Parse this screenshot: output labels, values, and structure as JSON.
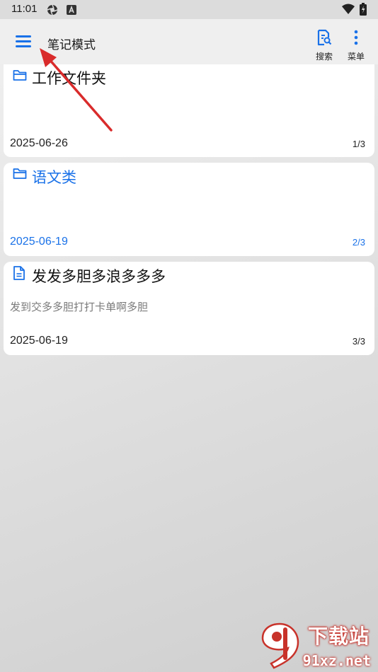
{
  "status_bar": {
    "time": "11:01"
  },
  "app_bar": {
    "title": "笔记模式",
    "actions": [
      {
        "label": "搜索",
        "icon": "search-note-icon"
      },
      {
        "label": "菜单",
        "icon": "more-vert-icon"
      }
    ]
  },
  "notes": [
    {
      "type": "folder",
      "title": "工作文件夹",
      "preview": "",
      "date": "2025-06-26",
      "position": "1/3",
      "accent": false
    },
    {
      "type": "folder",
      "title": "语文类",
      "preview": "",
      "date": "2025-06-19",
      "position": "2/3",
      "accent": true
    },
    {
      "type": "note",
      "title": "发发多胆多浪多多多",
      "preview": "发到交多多胆打打卡单啊多胆",
      "date": "2025-06-19",
      "position": "3/3",
      "accent": false
    }
  ],
  "colors": {
    "accent": "#1971e8",
    "arrow": "#d92b2b"
  },
  "watermark": {
    "main": "下载站",
    "sub": "91xz.net"
  }
}
